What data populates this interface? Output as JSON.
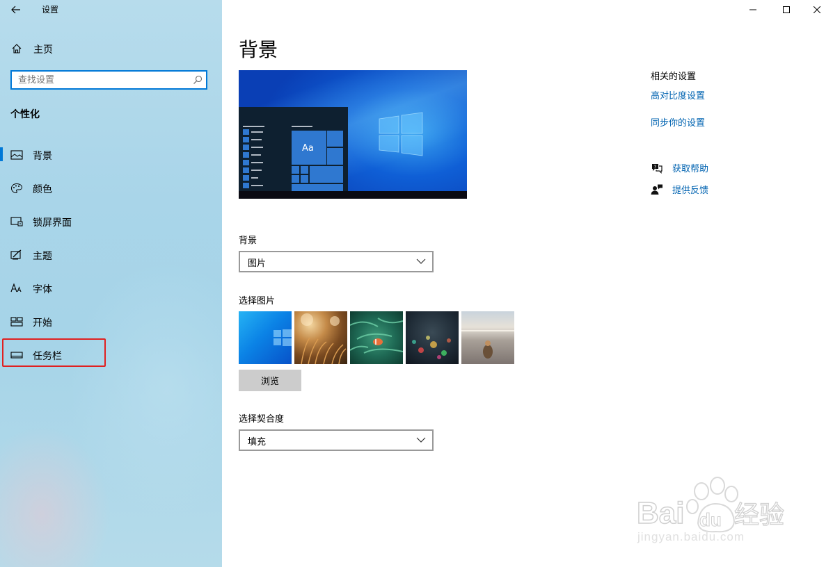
{
  "window": {
    "title": "设置",
    "back_label": "←"
  },
  "sidebar": {
    "home_label": "主页",
    "search_placeholder": "查找设置",
    "section_title": "个性化",
    "items": [
      {
        "label": "背景",
        "icon": "image-icon",
        "selected": true
      },
      {
        "label": "颜色",
        "icon": "palette-icon",
        "selected": false
      },
      {
        "label": "锁屏界面",
        "icon": "lock-screen-icon",
        "selected": false
      },
      {
        "label": "主题",
        "icon": "theme-brush-icon",
        "selected": false
      },
      {
        "label": "字体",
        "icon": "font-icon",
        "selected": false
      },
      {
        "label": "开始",
        "icon": "start-icon",
        "selected": false
      },
      {
        "label": "任务栏",
        "icon": "taskbar-icon",
        "selected": false
      }
    ]
  },
  "main": {
    "page_title": "背景",
    "preview_tile_label": "Aa",
    "background_label": "背景",
    "background_value": "图片",
    "choose_picture_label": "选择图片",
    "browse_label": "浏览",
    "fit_label": "选择契合度",
    "fit_value": "填充"
  },
  "related": {
    "title": "相关的设置",
    "links": [
      "高对比度设置",
      "同步你的设置"
    ],
    "help_label": "获取帮助",
    "feedback_label": "提供反馈"
  },
  "watermark": {
    "site": "jingyan.baidu.com"
  },
  "colors": {
    "accent": "#0078d7",
    "link": "#0063b1",
    "highlight_box": "#e02020"
  }
}
